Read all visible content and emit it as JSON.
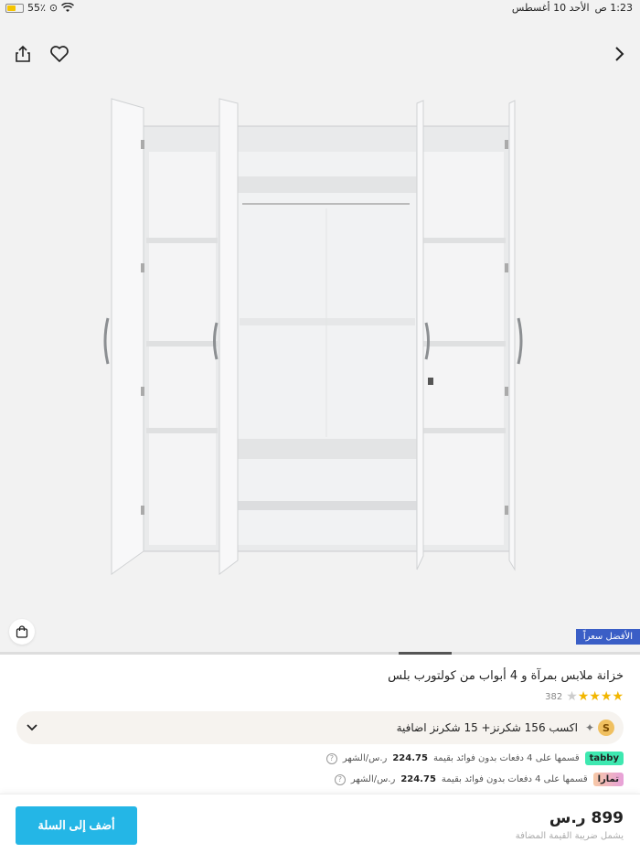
{
  "status_bar": {
    "battery": "55٪",
    "battery_level": 0.55,
    "time": "1:23 ص",
    "date": "الأحد 10 أغسطس"
  },
  "product": {
    "badge": "الأفضل سعراً",
    "title": "خزانة ملابس بمرآة و 4 أبواب من كولتورب بلس",
    "rating_count": "382",
    "rating_value": 4,
    "image_progress": {
      "total": 6,
      "current": 2
    }
  },
  "rewards": {
    "text": "اكسب 156 شكرنز+ 15 شكرنز اضافية",
    "coin_letter": "S"
  },
  "installments": [
    {
      "provider": "tabby",
      "text": "قسمها على 4 دفعات بدون فوائد بقيمة",
      "amount": "224.75",
      "unit": "ر.س/الشهر"
    },
    {
      "provider": "تمارا",
      "text": "قسمها على 4 دفعات بدون فوائد بقيمة",
      "amount": "224.75",
      "unit": "ر.س/الشهر"
    }
  ],
  "footer": {
    "price": "899 ر.س",
    "vat": "يشمل ضريبة القيمة المضافة",
    "add_to_cart": "أضف إلى السلة"
  },
  "colors": {
    "accent": "#24b6e6",
    "badge": "#3a5ec6",
    "star": "#f2b600",
    "tabby": "#3ee8b0"
  },
  "icons": [
    "share-icon",
    "heart-icon",
    "chevron-right-icon",
    "bag-icon",
    "chevron-down-icon",
    "wifi-icon"
  ]
}
